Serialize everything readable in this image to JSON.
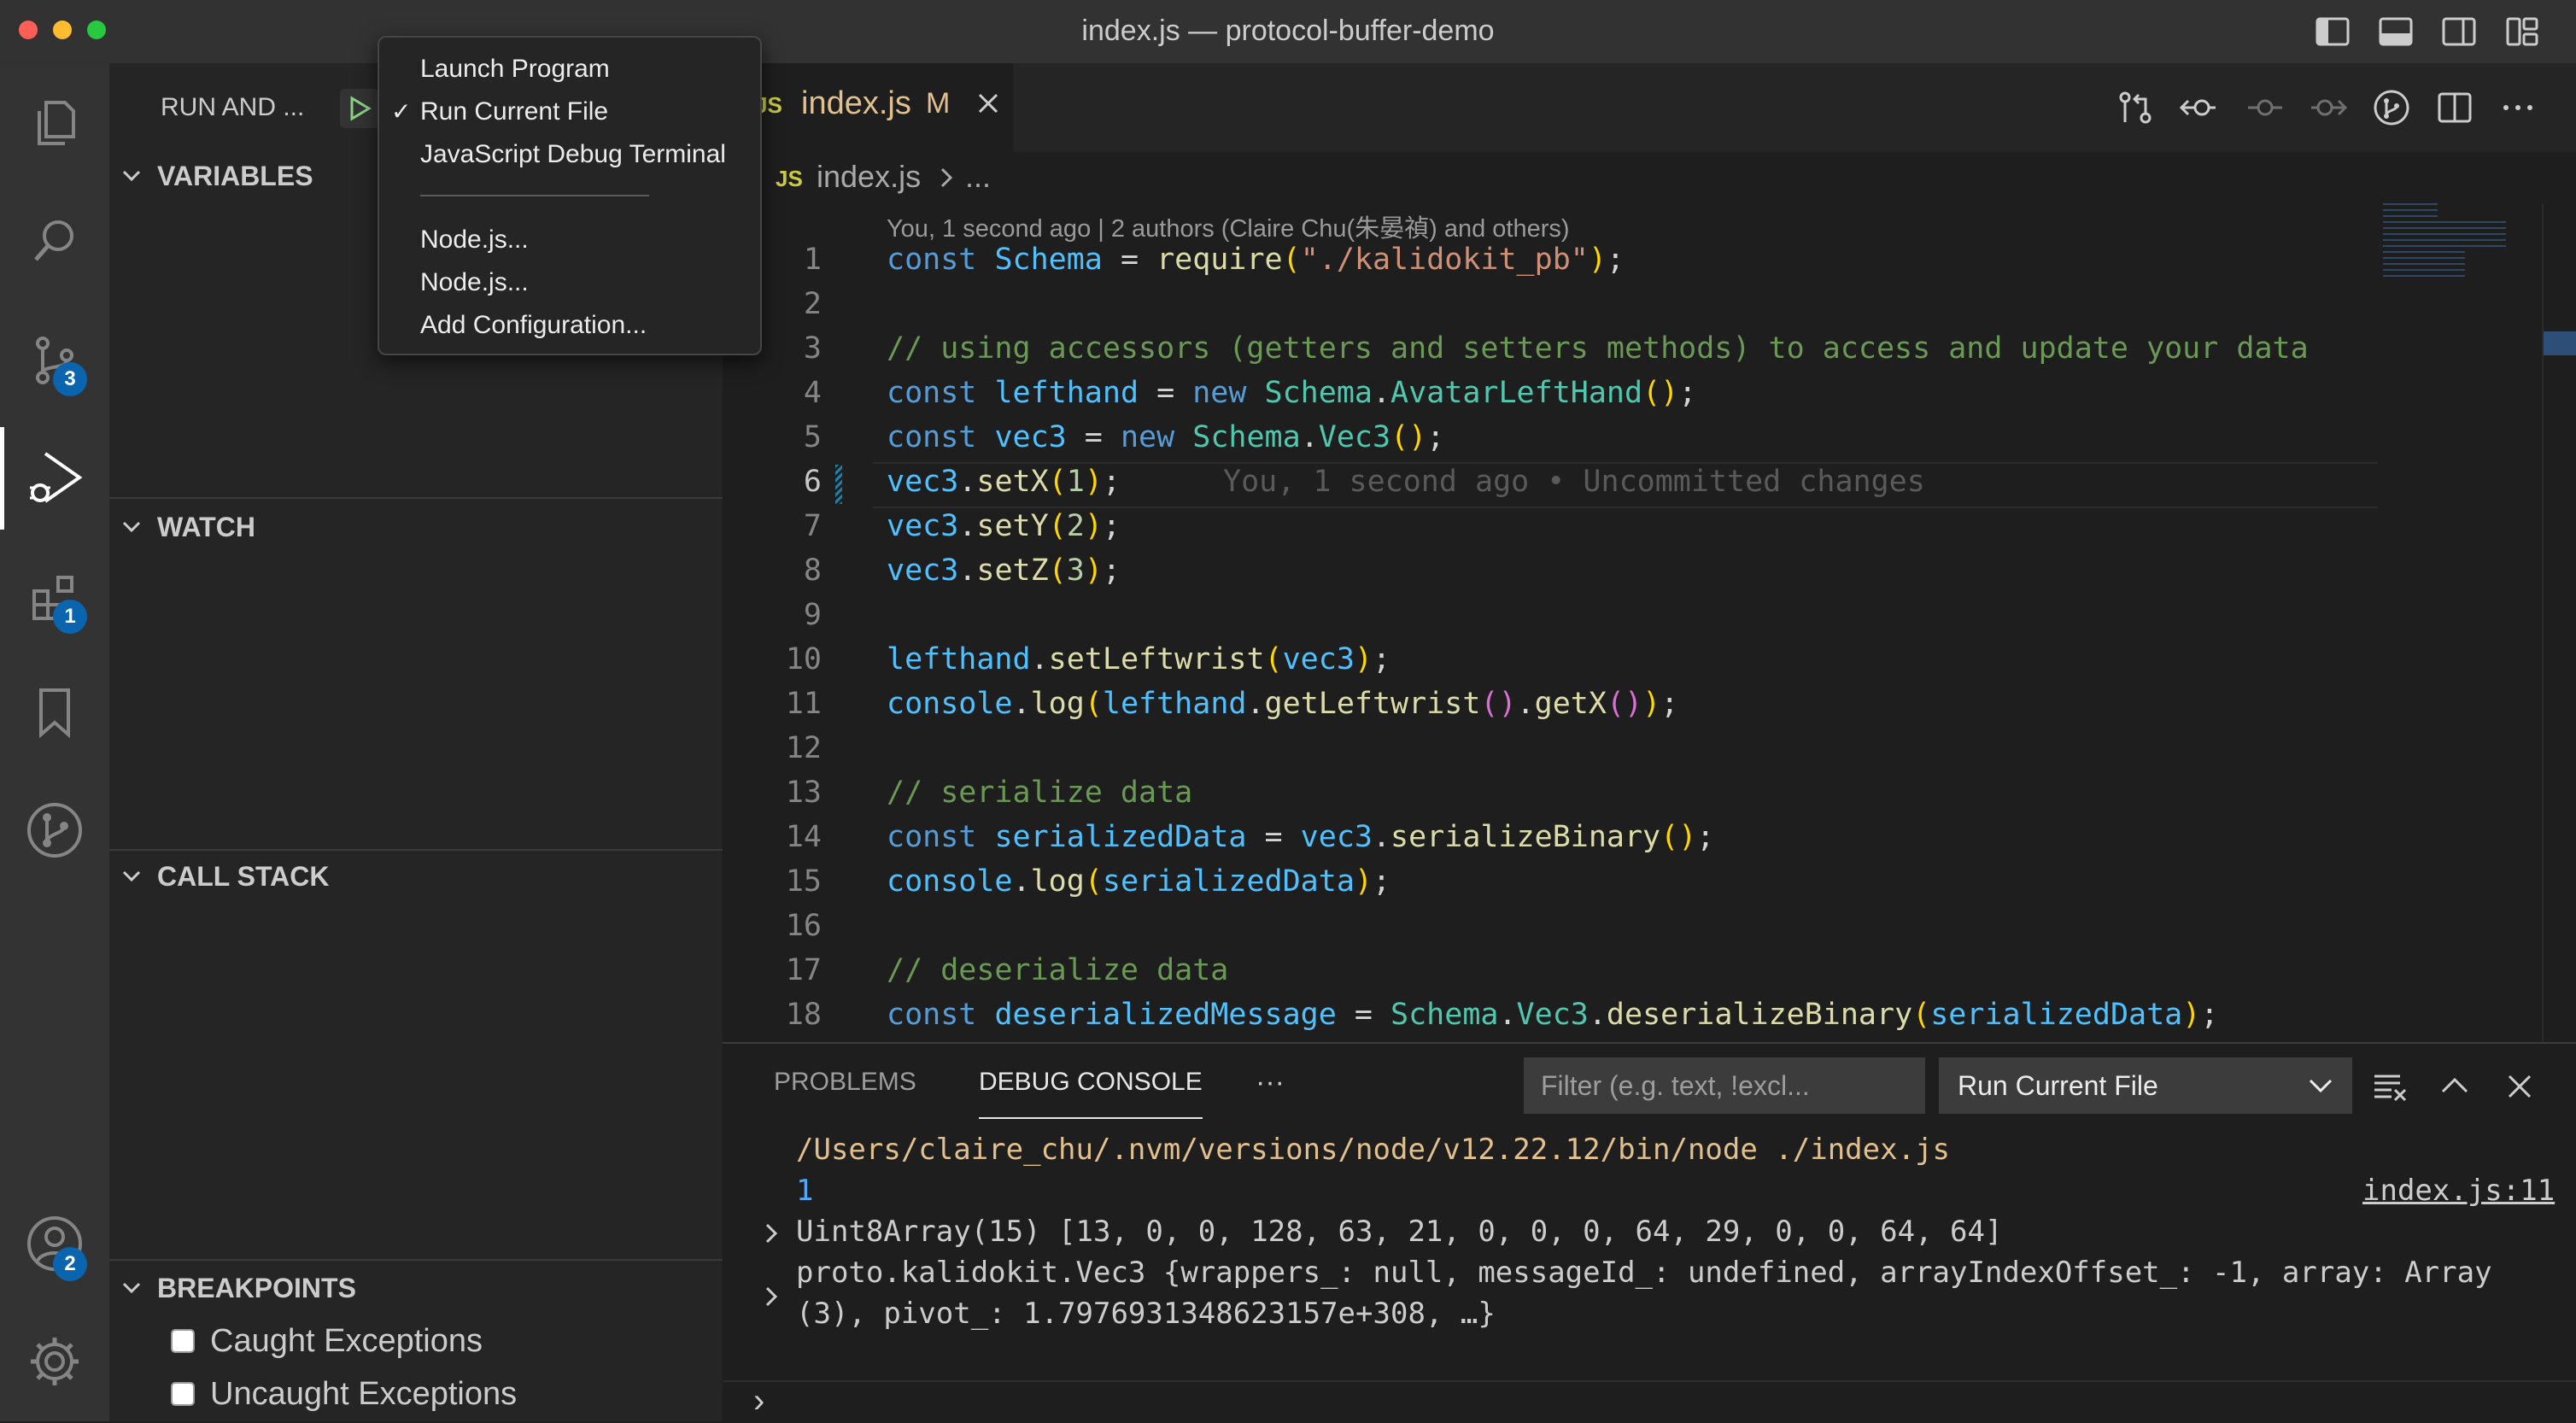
{
  "window": {
    "title": "index.js — protocol-buffer-demo",
    "traffic_colors": [
      "#ff5f57",
      "#febc2e",
      "#28c840"
    ]
  },
  "activity_bar": {
    "items": [
      {
        "icon": "files-icon"
      },
      {
        "icon": "search-icon"
      },
      {
        "icon": "source-control-icon",
        "badge": "3"
      },
      {
        "icon": "run-debug-icon",
        "active": true
      },
      {
        "icon": "extensions-icon",
        "badge": "1"
      },
      {
        "icon": "bookmark-icon"
      },
      {
        "icon": "git-graph-icon"
      }
    ],
    "accounts_badge": "2"
  },
  "sidebar": {
    "title": "RUN AND ...",
    "sections": {
      "variables": "VARIABLES",
      "watch": "WATCH",
      "call_stack": "CALL STACK",
      "breakpoints": "BREAKPOINTS"
    },
    "breakpoints": [
      {
        "label": "Caught Exceptions",
        "checked": false
      },
      {
        "label": "Uncaught Exceptions",
        "checked": false
      }
    ]
  },
  "run_menu": {
    "items": [
      {
        "label": "Launch Program",
        "checked": false
      },
      {
        "label": "Run Current File",
        "checked": true
      },
      {
        "label": "JavaScript Debug Terminal",
        "checked": false
      },
      {
        "label": "Node.js...",
        "checked": false
      },
      {
        "label": "Node.js...",
        "checked": false
      },
      {
        "label": "Add Configuration...",
        "checked": false
      }
    ],
    "checkmark": "✓"
  },
  "editor": {
    "tab": {
      "lang": "JS",
      "name": "index.js",
      "status": "M"
    },
    "breadcrumb": {
      "lang": "JS",
      "file": "index.js",
      "more": "..."
    },
    "codelens": "You, 1 second ago | 2 authors (Claire Chu(朱晏禎) and others)",
    "blame": "You, 1 second ago • Uncommitted changes",
    "lines": [
      "1",
      "2",
      "3",
      "4",
      "5",
      "6",
      "7",
      "8",
      "9",
      "10",
      "11",
      "12",
      "13",
      "14",
      "15",
      "16",
      "17",
      "18"
    ],
    "current_line": "6"
  },
  "panel": {
    "tabs": {
      "problems": "PROBLEMS",
      "debug_console": "DEBUG CONSOLE",
      "more": "···"
    },
    "filter_placeholder": "Filter (e.g. text, !excl...",
    "config_select": "Run Current File",
    "output": {
      "cmd": "/Users/claire_chu/.nvm/versions/node/v12.22.12/bin/node ./index.js",
      "value": "1",
      "source": "index.js:11",
      "uint8": "Uint8Array(15) [13, 0, 0, 128, 63, 21, 0, 0, 0, 64, 29, 0, 0, 64, 64]",
      "obj_line1": "proto.kalidokit.Vec3 {wrappers_: null, messageId_: undefined, arrayIndexOffset_: -1, array: Array",
      "obj_line2": "(3), pivot_: 1.7976931348623157e+308, …}",
      "prompt": "›"
    }
  }
}
